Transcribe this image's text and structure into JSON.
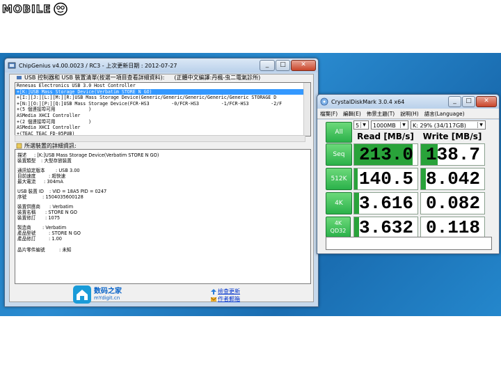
{
  "chipgenius": {
    "title": "ChipGenius v4.00.0023 / RC3 - 上次更新日期  : 2012-07-27",
    "device_list_label": "USB 控制器和 USB 裝置清單(按選一項目查看詳細資料):",
    "credit": "(正體中文編譯:丹楓-虫二電氣診所)",
    "devices": [
      "Renesas Electronics USB 3.0 Host Controller",
      "+[K:]USB Mass Storage Device(Verbatim STORE N GO)",
      "+[I:][J:][L:][M:][R:]USB Mass Storage Device(Generic/Generic/Generic/Generic/Generic STORAGE D",
      "+[N:][O:][P:][Q:]USB Mass Storage Device(FCR-HS3        -0/FCR-HS3        -1/FCR-HS3        -2/F",
      "+(5 個連接埠可用            )",
      "ASMedia XHCI Controller",
      "+(2 個連接埠可用            )",
      "ASMedia XHCI Controller",
      "+(TEAC TEAC FD-05PUB)"
    ],
    "details_label": "所選裝置的詳細資訊:",
    "details": [
      {
        "label": "描述",
        "value": ": [K:]USB Mass Storage Device(Verbatim STORE N GO)"
      },
      {
        "label": "裝置類型",
        "value": ":    大型存放裝置"
      },
      {
        "label": "通訊協定版本",
        "value": ": USB 3.00"
      },
      {
        "label": "目前速度",
        "value": ": 超快速"
      },
      {
        "label": "最大電流",
        "value": ": 304mA"
      },
      {
        "label": "USB 裝置 ID",
        "value": ": VID = 18A5 PID = 0247"
      },
      {
        "label": "序號",
        "value": ": 1504035600128"
      },
      {
        "label": "裝置供應商",
        "value": ": Verbatim"
      },
      {
        "label": "裝置名稱",
        "value": ": STORE N GO"
      },
      {
        "label": "裝置修訂",
        "value": ": 1075"
      },
      {
        "label": "製造商",
        "value": ": Verbatim"
      },
      {
        "label": "產品型號",
        "value": ": STORE N GO"
      },
      {
        "label": "產品修訂",
        "value": ": 1.00"
      },
      {
        "label": "晶片零件編號",
        "value": ": 未知"
      }
    ],
    "footer_brand": "数码之家",
    "footer_url": "mYdigit.cn",
    "check_update": "檢查更新",
    "author_email": "作者郵箱"
  },
  "cdm": {
    "title": "CrystalDiskMark 3.0.4 x64",
    "menu": [
      "檔案(F)",
      "編輯(E)",
      "佈景主題(T)",
      "說明(H)",
      "語言(Language)"
    ],
    "all_button": "All",
    "count": "5",
    "size": "1000MB",
    "drive": "K: 29% (34/117GB)",
    "read_header": "Read [MB/s]",
    "write_header": "Write [MB/s]",
    "rows": [
      {
        "label": "Seq",
        "label2": "",
        "read": "213.0",
        "write": "138.7"
      },
      {
        "label": "512K",
        "label2": "",
        "read": "140.5",
        "write": "8.042"
      },
      {
        "label": "4K",
        "label2": "",
        "read": "3.616",
        "write": "0.082"
      },
      {
        "label": "4K",
        "label2": "QD32",
        "read": "3.632",
        "write": "0.118"
      }
    ]
  }
}
